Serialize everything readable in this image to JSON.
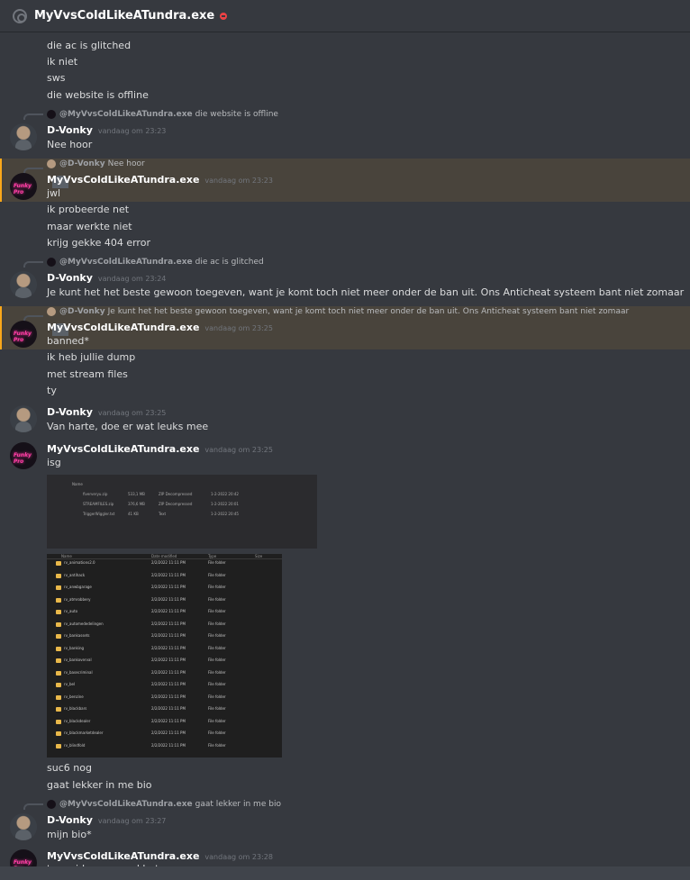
{
  "header": {
    "title": "MyVvsColdLikeATundra.exe"
  },
  "users": {
    "d": "D-Vonky",
    "m": "MyVvsColdLikeATundra.exe"
  },
  "avatar_text": "Funky Pro",
  "lines": {
    "l1": "die ac is glitched",
    "l2": "ik niet",
    "l3": "sws",
    "l4": "die website is offline",
    "l5": "Nee hoor",
    "l6": "jwl",
    "l7": "ik probeerde net",
    "l8": "maar werkte niet",
    "l9": "krijg gekke 404 error",
    "l10": "Je kunt het het beste gewoon toegeven, want je komt toch niet meer onder de ban uit. Ons Anticheat systeem bant niet zomaar",
    "l11": "banned*",
    "l12": "ik heb jullie dump",
    "l13": "met stream files",
    "l14": "ty",
    "l15": "Van harte, doe er wat leuks mee",
    "l16": "isg",
    "l17": "suc6 nog",
    "l18": "gaat lekker in me bio",
    "l19": "mijn bio*",
    "l20": "team idee was wel beter"
  },
  "replies": {
    "r1": {
      "user": "@MyVvsColdLikeATundra.exe",
      "text": "die website is offline"
    },
    "r2": {
      "user": "@D-Vonky",
      "text": "Nee hoor"
    },
    "r3": {
      "user": "@MyVvsColdLikeATundra.exe",
      "text": "die ac is glitched"
    },
    "r4": {
      "user": "@D-Vonky",
      "text": "Je kunt het het beste gewoon toegeven, want je komt toch niet meer onder de ban uit. Ons Anticheat systeem bant niet zomaar"
    },
    "r5": {
      "user": "@MyVvsColdLikeATundra.exe",
      "text": "gaat lekker in me bio"
    }
  },
  "timestamps": {
    "t1": "vandaag om 23:23",
    "t2": "vandaag om 23:23",
    "t3": "vandaag om 23:24",
    "t4": "vandaag om 23:25",
    "t5": "vandaag om 23:25",
    "t6": "vandaag om 23:25",
    "t7": "vandaag om 23:27",
    "t8": "vandaag om 23:28"
  },
  "image1": {
    "header": "Name",
    "files": [
      {
        "name": "fiververyu.zip",
        "size": "533,1 MB",
        "type": "ZIP Decompressed",
        "date": "1-2-2022 20:42"
      },
      {
        "name": "STREAMFILES.zip",
        "size": "376,6 MB",
        "type": "ZIP Decompressed",
        "date": "1-2-2022 20:01"
      },
      {
        "name": "TriggerWiggler.txt",
        "size": "41 KB",
        "type": "Text",
        "date": "1-2-2022 20:45"
      }
    ]
  },
  "image2": {
    "headers": [
      "Name",
      "Date modified",
      "Type",
      "Size"
    ],
    "date": "2/2/2022 11:11 PM",
    "type": "File folder",
    "folders": [
      "rv_animations2.0",
      "rv_antihack",
      "rv_anwbgarage",
      "rv_atmrobbery",
      "rv_auto",
      "rv_automededelingen",
      "rv_bankassets",
      "rv_banking",
      "rv_bankoverval",
      "rv_basecriminal",
      "rv_bel",
      "rv_benzine",
      "rv_blackbars",
      "rv_blackdealer",
      "rv_blackmarketdealer",
      "rv_blindfold"
    ]
  },
  "colors": {
    "background": "#36393f",
    "mention_highlight": "#49443c",
    "mention_bar": "#faa81a",
    "status_dnd": "#ed4245"
  }
}
